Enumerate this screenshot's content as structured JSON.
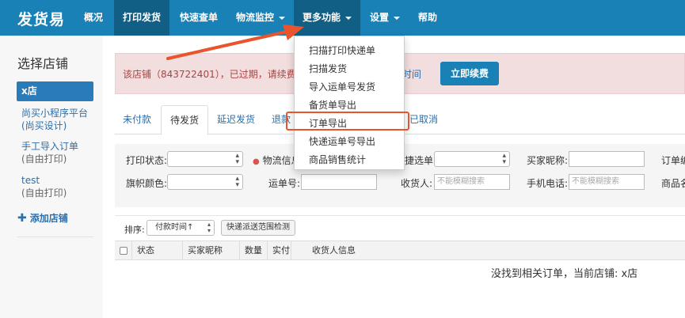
{
  "topnav": {
    "brand": "发货易",
    "items": [
      {
        "label": "概况"
      },
      {
        "label": "打印发货"
      },
      {
        "label": "快速查单"
      },
      {
        "label": "物流监控"
      },
      {
        "label": "更多功能"
      },
      {
        "label": "设置"
      },
      {
        "label": "帮助"
      }
    ]
  },
  "dropdown": {
    "items": [
      "扫描打印快递单",
      "扫描发货",
      "导入运单号发货",
      "备货单导出",
      "订单导出",
      "快递运单号导出",
      "商品销售统计"
    ]
  },
  "sidebar": {
    "title": "选择店铺",
    "active_store": "x店",
    "links": [
      {
        "label": "尚买小程序平台",
        "sub": "(尚买设计)"
      },
      {
        "label": "手工导入订单",
        "sub": "(自由打印)"
      },
      {
        "label": "test",
        "sub": "(自由打印)"
      }
    ],
    "add_label": "添加店铺"
  },
  "alert": {
    "text": "该店铺（843722401），已过期，请续费。",
    "link": "时间",
    "button": "立即续费"
  },
  "tabs": [
    "未付款",
    "待发货",
    "延迟发货",
    "退款",
    "已取消"
  ],
  "filters": {
    "print_status": "打印状态:",
    "logistics_info": "物流信息",
    "express_label": "捷选单:",
    "buyer_nick": "买家昵称:",
    "order_no": "订单编",
    "flag_color": "旗帜颜色:",
    "waybill": "运单号:",
    "receiver": "收货人:",
    "receiver_placeholder": "不能模糊搜索",
    "phone": "手机电话:",
    "phone_placeholder": "不能模糊搜索",
    "goods_name": "商品名"
  },
  "sort": {
    "label": "排序:",
    "selected": "付款时间↑",
    "range_button": "快递派送范围检测"
  },
  "table": {
    "headers": [
      "状态",
      "买家昵称",
      "数量",
      "实付",
      "收货人信息"
    ]
  },
  "empty_message": "没找到相关订单，当前店铺: x店",
  "colors": {
    "nav_bg": "#1a81b7",
    "nav_active": "#125f86",
    "alert_bg": "#f2dede",
    "highlight": "#e8552d"
  }
}
